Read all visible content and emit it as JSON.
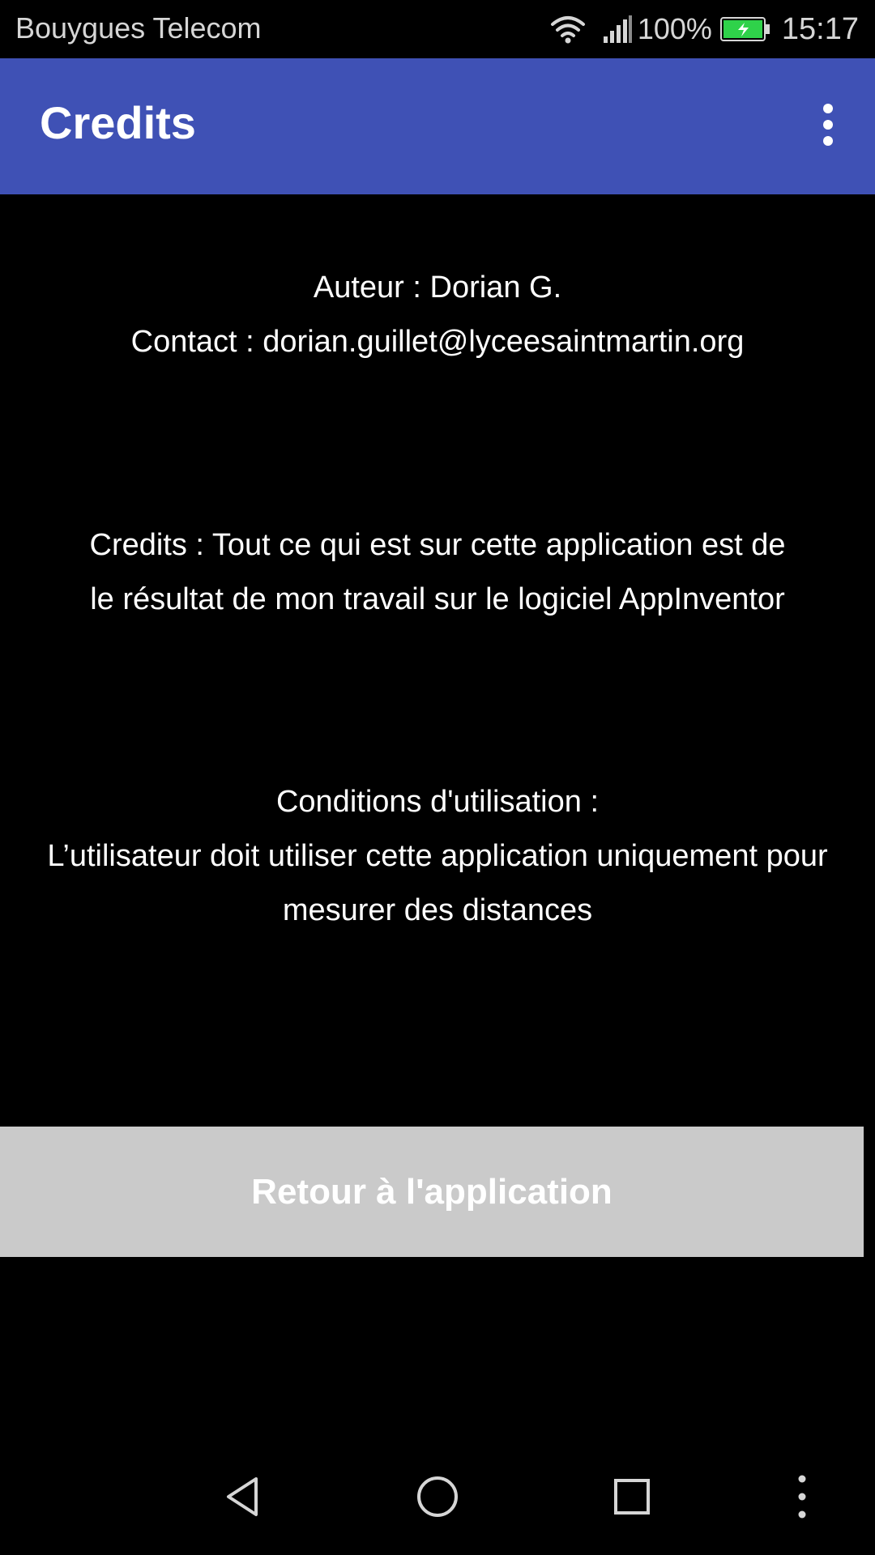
{
  "status_bar": {
    "carrier": "Bouygues Telecom",
    "battery_percent": "100%",
    "time": "15:17",
    "battery_color": "#2FD24A"
  },
  "app_bar": {
    "title": "Credits",
    "background": "#3F51B5",
    "overflow_icon": "more-vert-icon"
  },
  "content": {
    "author": "Auteur : Dorian G.",
    "contact": "Contact : dorian.guillet@lyceesaintmartin.org",
    "credits_line1": "Credits : Tout ce qui est sur cette application est de",
    "credits_line2": "le résultat de mon travail sur le logiciel AppInventor",
    "conditions_title": "Conditions d'utilisation :",
    "conditions_line1": "L’utilisateur doit utiliser cette application uniquement pour",
    "conditions_line2": "mesurer des distances"
  },
  "button": {
    "label": "Retour à l'application"
  },
  "nav_bar": {
    "icons": [
      "back-triangle-icon",
      "home-circle-icon",
      "recents-square-icon",
      "more-vert-icon"
    ]
  }
}
